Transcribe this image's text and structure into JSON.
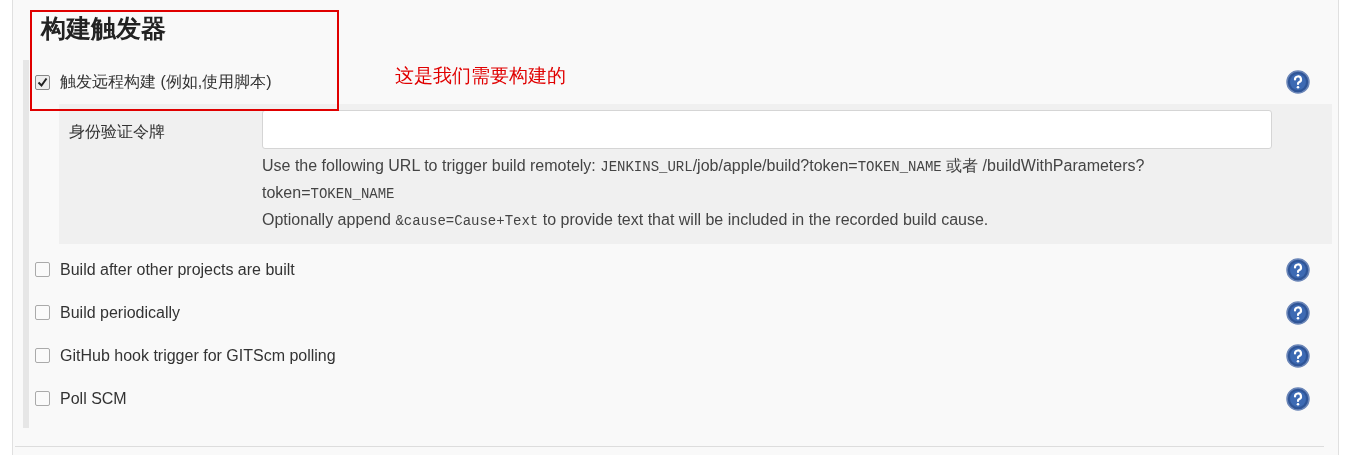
{
  "section": {
    "title": "构建触发器"
  },
  "annotation": {
    "text": "这是我们需要构建的"
  },
  "triggers": [
    {
      "label": "触发远程构建 (例如,使用脚本)",
      "checked": true
    },
    {
      "label": "Build after other projects are built",
      "checked": false
    },
    {
      "label": "Build periodically",
      "checked": false
    },
    {
      "label": "GitHub hook trigger for GITScm polling",
      "checked": false
    },
    {
      "label": "Poll SCM",
      "checked": false
    }
  ],
  "token_field": {
    "label": "身份验证令牌",
    "help_lines": [
      [
        {
          "kind": "text",
          "text": "Use the following URL to trigger build remotely: "
        },
        {
          "kind": "code",
          "text": "JENKINS_URL"
        },
        {
          "kind": "text",
          "text": "/job/apple/build?token="
        },
        {
          "kind": "code",
          "text": "TOKEN_NAME"
        },
        {
          "kind": "text",
          "text": " 或者 /buildWithParameters?"
        }
      ],
      [
        {
          "kind": "text",
          "text": "token="
        },
        {
          "kind": "code",
          "text": "TOKEN_NAME"
        }
      ],
      [
        {
          "kind": "text",
          "text": "Optionally append "
        },
        {
          "kind": "code",
          "text": "&cause=Cause+Text"
        },
        {
          "kind": "text",
          "text": " to provide text that will be included in the recorded build cause."
        }
      ]
    ]
  }
}
